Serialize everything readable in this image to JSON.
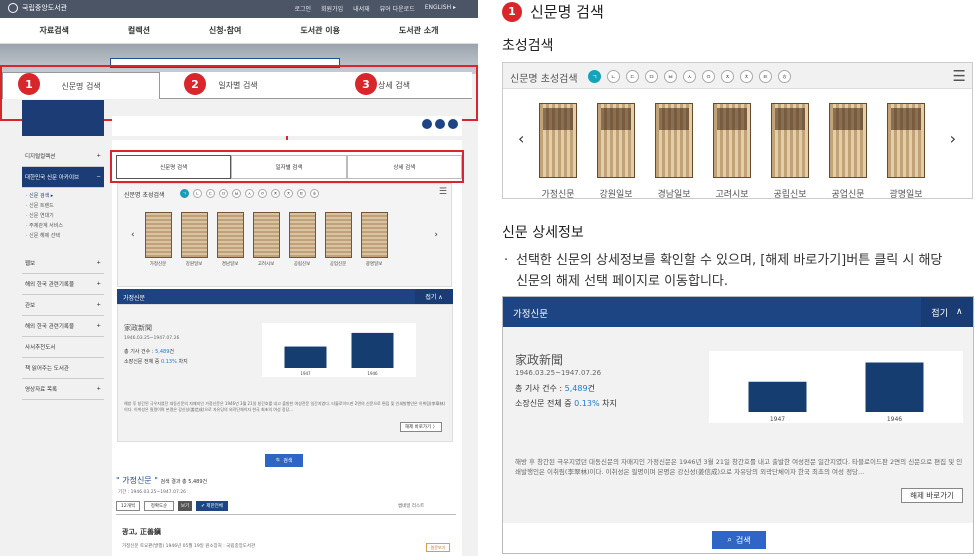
{
  "left": {
    "top_links": [
      "로그인",
      "회원가입",
      "내서재",
      "뷰어 다운로드",
      "ENGLISH ▸"
    ],
    "logo": "국립중앙도서관",
    "nav": [
      "자료검색",
      "컬렉션",
      "신청·참여",
      "도서관 이용",
      "도서관 소개"
    ],
    "big_tabs": [
      "신문명 검색",
      "일자별 검색",
      "상세 검색"
    ],
    "badges": [
      "1",
      "2",
      "3"
    ],
    "sidebar": {
      "items": [
        {
          "label": "디지털컬렉션",
          "mark": "+"
        },
        {
          "label": "대한민국 신문 아카이브",
          "mark": "−"
        }
      ],
      "subs": [
        "· 신문 검색 ▸",
        "· 신문 트렌드",
        "· 신문 연대기",
        "· 주제관계 서비스",
        "· 신문 해제 선택"
      ],
      "more": [
        {
          "label": "웹보",
          "mark": "+"
        },
        {
          "label": "해외 한국 관련기록물",
          "mark": "+"
        },
        {
          "label": "관보",
          "mark": "+"
        },
        {
          "label": "해외 한국 관련기록물",
          "mark": "+"
        },
        {
          "label": "사서추천도서",
          "mark": ""
        },
        {
          "label": "책 읽어주는 도서관",
          "mark": ""
        },
        {
          "label": "영상자료 목록",
          "mark": "+"
        }
      ]
    },
    "small_tabs": [
      "신문명 검색",
      "일자별 검색",
      "상세 검색"
    ],
    "panel_title": "신문명 초성검색",
    "chips": [
      "ㄱ",
      "ㄴ",
      "ㄷ",
      "ㅁ",
      "ㅂ",
      "ㅅ",
      "ㅇ",
      "ㅈ",
      "ㅊ",
      "ㅌ",
      "ㅎ"
    ],
    "papers": [
      "가정신문",
      "강원일보",
      "경남일보",
      "고려시보",
      "공립신보",
      "공업신문",
      "광명일보"
    ],
    "info": {
      "header": "가정신문",
      "fold": "접기 ∧",
      "name": "家政新聞",
      "period": "1946.03.25~1947.07.26",
      "total_label": "총 기사 건수 :",
      "total_value": "5,489",
      "total_unit": "건",
      "held_label": "소장신문 전체 중",
      "held_value": "0.13%",
      "held_unit": "차지",
      "years": [
        "1947",
        "1946"
      ],
      "desc": "해방 후 창간된 극우지였던 대동신문의 자매지인 가정신문은 1946년 3월 21일 창간호를 내고 출발한 여성전문 일간지였다. 타블로이드판 2면의 신문으로 편집 및 인쇄발행인은 이취림(李翠林)이다. 이취성은 필명이며 본명은 강신성(姜信成)으로 자유당의 외곽단체이자 한국 최초의 여성 정당...",
      "goto": "해제 바로가기 〉",
      "search": "🔍 검색"
    },
    "result": {
      "title": "\" 가정신문 \"",
      "count": "검색 결과 총 5,489건",
      "period": "기간 : 1946.03.25~1947.07.26",
      "per_page": "12개씩",
      "sort": "정확도순",
      "view": "보기",
      "select": "✔ 제한전체",
      "list_toggle": "썸네일  리스트",
      "item_title": "광고, 正善鎭",
      "item_meta": "가정신문   토요판(발행)   1946년 05월 19일   원소장처 : 국립중앙도서관",
      "item_btn": "원문보기"
    }
  },
  "right": {
    "section_badge": "1",
    "section_title": "신문명 검색",
    "chosung_title": "초성검색",
    "box_label": "신문명 초성검색",
    "chips": [
      "ㄱ",
      "ㄴ",
      "ㄷ",
      "ㅁ",
      "ㅂ",
      "ㅅ",
      "ㅇ",
      "ㅈ",
      "ㅊ",
      "ㅌ",
      "ㅎ"
    ],
    "papers": [
      "가정신문",
      "강원일보",
      "경남일보",
      "고려시보",
      "공립신보",
      "공업신문",
      "광명일보"
    ],
    "detail_title": "신문 상세정보",
    "detail_desc": "선택한 신문의 상세정보를 확인할 수 있으며, [해제 바로가기]버튼 클릭 시 해당 신문의 해제 선택 페이지로 이동합니다.",
    "info": {
      "header": "가정신문",
      "fold": "접기",
      "name": "家政新聞",
      "period": "1946.03.25~1947.07.26",
      "total_label": "총 기사 건수 :",
      "total_value": "5,489",
      "total_unit": "건",
      "held_label": "소장신문 전체 중",
      "held_value": "0.13%",
      "held_unit": "차지",
      "desc": "해방 후 창간된 극우지였던 대동신문의 자매지인 가정신문은 1946년 3월 21일 창간호를 내고 출발한 여성전문 일간지였다. 타블로이드판 2면의 신문으로 편집 및 인쇄발행인은 이취림(李翠林)이다. 이취성은 필명이며 본명은 강신성(姜信成)으로 자유당의 외곽단체이자 한국 최초의 여성 정당...",
      "goto": "해제 바로가기",
      "search": "검색"
    }
  },
  "chart_data": {
    "type": "bar",
    "categories": [
      "1947",
      "1946"
    ],
    "values": [
      0.55,
      0.9
    ],
    "ylim": [
      0,
      1
    ]
  },
  "colors": {
    "accent": "#d9262b",
    "navy": "#1d4583",
    "teal": "#16a2bc",
    "button": "#2f65c4"
  }
}
